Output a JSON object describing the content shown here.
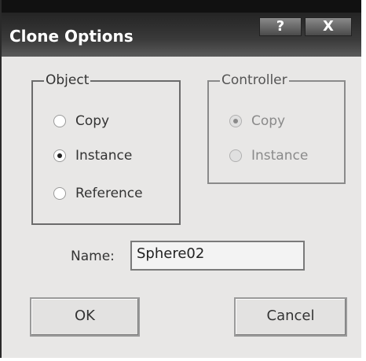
{
  "window": {
    "title": "Clone Options",
    "help_label": "?",
    "close_label": "X"
  },
  "object_group": {
    "legend": "Object",
    "options": [
      {
        "label": "Copy",
        "checked": false
      },
      {
        "label": "Instance",
        "checked": true
      },
      {
        "label": "Reference",
        "checked": false
      }
    ]
  },
  "controller_group": {
    "legend": "Controller",
    "enabled": false,
    "options": [
      {
        "label": "Copy",
        "checked": true
      },
      {
        "label": "Instance",
        "checked": false
      }
    ]
  },
  "name_field": {
    "label": "Name:",
    "value": "Sphere02"
  },
  "buttons": {
    "ok_label": "OK",
    "cancel_label": "Cancel"
  }
}
